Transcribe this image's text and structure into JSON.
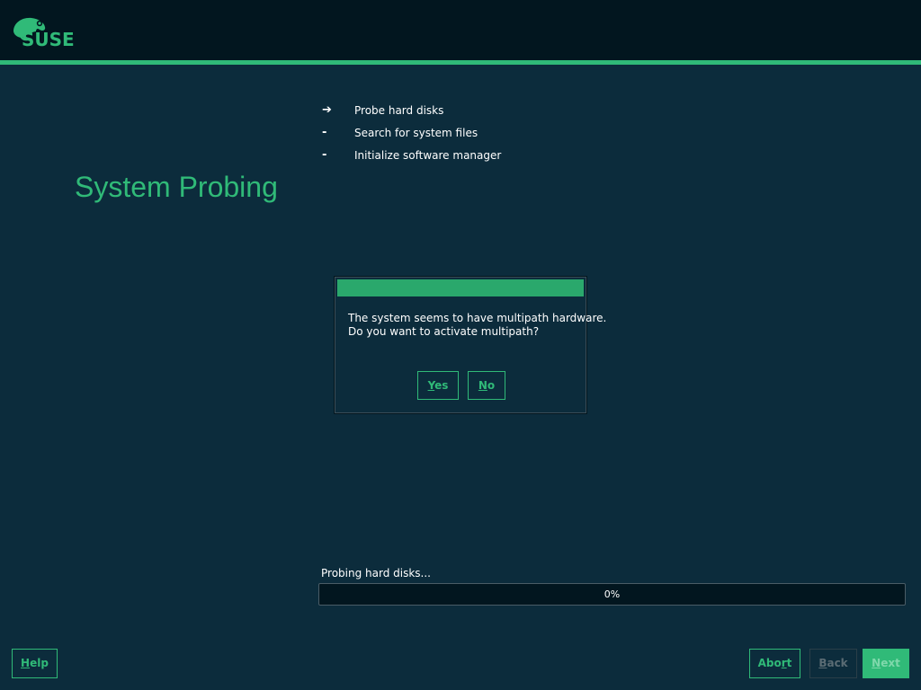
{
  "brand": {
    "logo_text": "SUSE",
    "accent_color": "#30ba78",
    "background_color": "#0c2c3c",
    "header_color": "#02161f"
  },
  "page": {
    "title": "System Probing"
  },
  "steps": [
    {
      "marker": "➔",
      "label": "Probe hard disks",
      "state": "current"
    },
    {
      "marker": "-",
      "label": "Search for system files",
      "state": "pending"
    },
    {
      "marker": "-",
      "label": "Initialize software manager",
      "state": "pending"
    }
  ],
  "dialog": {
    "message_line1": "The system seems to have multipath hardware.",
    "message_line2": "Do you want to activate multipath?",
    "yes": {
      "hotkey": "Y",
      "rest": "es"
    },
    "no": {
      "hotkey": "N",
      "rest": "o"
    }
  },
  "progress": {
    "label": "Probing hard disks...",
    "value": 0,
    "text": "0%"
  },
  "buttons": {
    "help": {
      "hotkey": "H",
      "rest": "elp"
    },
    "abort": {
      "pre": "Abo",
      "hotkey": "r",
      "rest": "t"
    },
    "back": {
      "hotkey": "B",
      "rest": "ack",
      "enabled": false
    },
    "next": {
      "hotkey": "N",
      "rest": "ext",
      "enabled": false
    }
  }
}
